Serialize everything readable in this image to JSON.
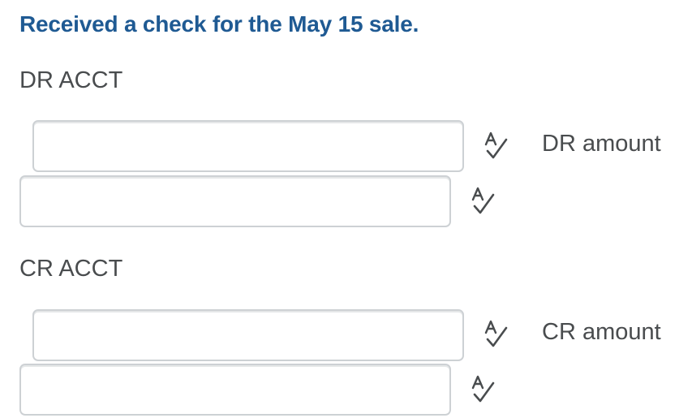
{
  "question": {
    "text": "Received a check for the May 15 sale."
  },
  "debit": {
    "section_label": "DR ACCT",
    "account_field": {
      "value": "",
      "placeholder": ""
    },
    "amount_field": {
      "value": "",
      "placeholder": ""
    },
    "amount_label": "DR amount"
  },
  "credit": {
    "section_label": "CR ACCT",
    "account_field": {
      "value": "",
      "placeholder": ""
    },
    "amount_field": {
      "value": "",
      "placeholder": ""
    },
    "amount_label": "CR amount"
  },
  "icons": {
    "spellcheck": "spellcheck-icon"
  },
  "colors": {
    "question_text": "#1f5a93",
    "label_text": "#494c4e",
    "field_border": "#cdd1d4"
  }
}
